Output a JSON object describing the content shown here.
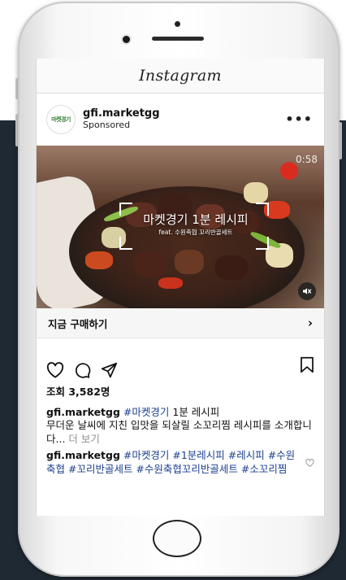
{
  "app": {
    "title": "Instagram"
  },
  "post": {
    "avatar_text": "마켓경기",
    "username": "gfi.marketgg",
    "sponsored": "Sponsored",
    "more_icon": "more-horizontal-icon",
    "media": {
      "timer": "0:58",
      "overlay_title": "마켓경기 1분 레시피",
      "overlay_subtitle": "feat. 수원축협 꼬리반골세트",
      "mute_icon": "speaker-muted-icon"
    },
    "cta": {
      "label": "지금 구매하기",
      "arrow": "›"
    },
    "actions": [
      "heart-icon",
      "comment-icon",
      "share-icon",
      "bookmark-icon"
    ],
    "views": "조회 3,582명",
    "caption": {
      "username": "gfi.marketgg",
      "hashtag": "#마켓경기",
      "text_after_tag": " 1분 레시피",
      "body": "무더운 날씨에 지친 입맛을 되살릴 소꼬리찜 레시피를 소개합니다...",
      "more": "더 보기"
    },
    "comment": {
      "username": "gfi.marketgg",
      "hashtags": "#마켓경기 #1분레시피 #레시피 #수원축협 #꼬리반골세트 #수원축협꼬리반골세트 #소꼬리찜",
      "like_icon": "small-heart-icon"
    }
  }
}
